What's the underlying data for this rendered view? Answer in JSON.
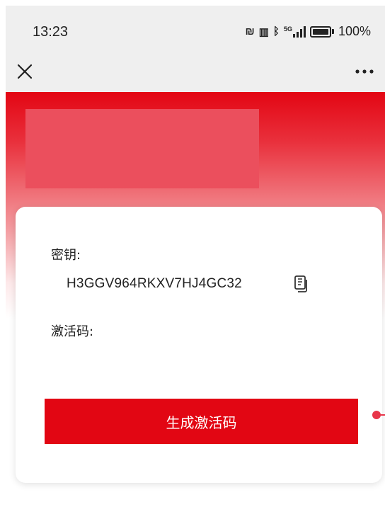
{
  "status_bar": {
    "time": "13:23",
    "icons": [
      "nfc-icon",
      "vibrate-icon",
      "bluetooth-icon",
      "signal-5g-icon",
      "battery-icon"
    ],
    "network": "5G",
    "battery": "100%"
  },
  "nav": {
    "close_icon": "close-icon",
    "more_icon": "more-icon"
  },
  "hero": {
    "accent_color": "#e30613"
  },
  "card": {
    "key_label": "密钥:",
    "key_value": "H3GGV964RKXV7HJ4GC32",
    "copy_icon": "copy-icon",
    "code_label": "激活码:",
    "code_value": "",
    "generate_button": "生成激活码"
  },
  "colors": {
    "primary": "#e20613",
    "status_bar_bg": "#efefef"
  }
}
